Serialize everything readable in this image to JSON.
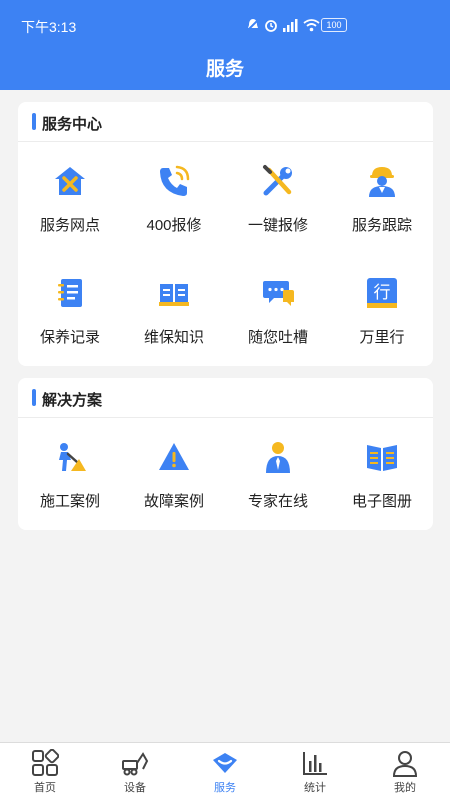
{
  "status_bar": {
    "time": "下午3:13",
    "battery": "100"
  },
  "header": {
    "title": "服务"
  },
  "service_center": {
    "title": "服务中心",
    "items": [
      {
        "label": "服务网点",
        "icon": "house-tools-icon"
      },
      {
        "label": "400报修",
        "icon": "phone-icon"
      },
      {
        "label": "一键报修",
        "icon": "wrench-screwdriver-icon"
      },
      {
        "label": "服务跟踪",
        "icon": "worker-icon"
      },
      {
        "label": "保养记录",
        "icon": "notebook-icon"
      },
      {
        "label": "维保知识",
        "icon": "open-book-icon"
      },
      {
        "label": "随您吐槽",
        "icon": "chat-bubble-icon"
      },
      {
        "label": "万里行",
        "icon": "xing-character-icon",
        "glyph": "行"
      }
    ]
  },
  "solutions": {
    "title": "解决方案",
    "items": [
      {
        "label": "施工案例",
        "icon": "construction-worker-icon"
      },
      {
        "label": "故障案例",
        "icon": "warning-triangle-icon"
      },
      {
        "label": "专家在线",
        "icon": "expert-person-icon"
      },
      {
        "label": "电子图册",
        "icon": "manual-book-icon"
      }
    ]
  },
  "tab_bar": {
    "tabs": [
      {
        "label": "首页",
        "icon": "grid-home-icon",
        "active": false
      },
      {
        "label": "设备",
        "icon": "excavator-icon",
        "active": false
      },
      {
        "label": "服务",
        "icon": "service-diamond-icon",
        "active": true
      },
      {
        "label": "统计",
        "icon": "bar-chart-icon",
        "active": false
      },
      {
        "label": "我的",
        "icon": "person-icon",
        "active": false
      }
    ]
  },
  "colors": {
    "primary": "#3d82f3",
    "accent_yellow": "#f5b820",
    "background": "#f3f3f3"
  }
}
